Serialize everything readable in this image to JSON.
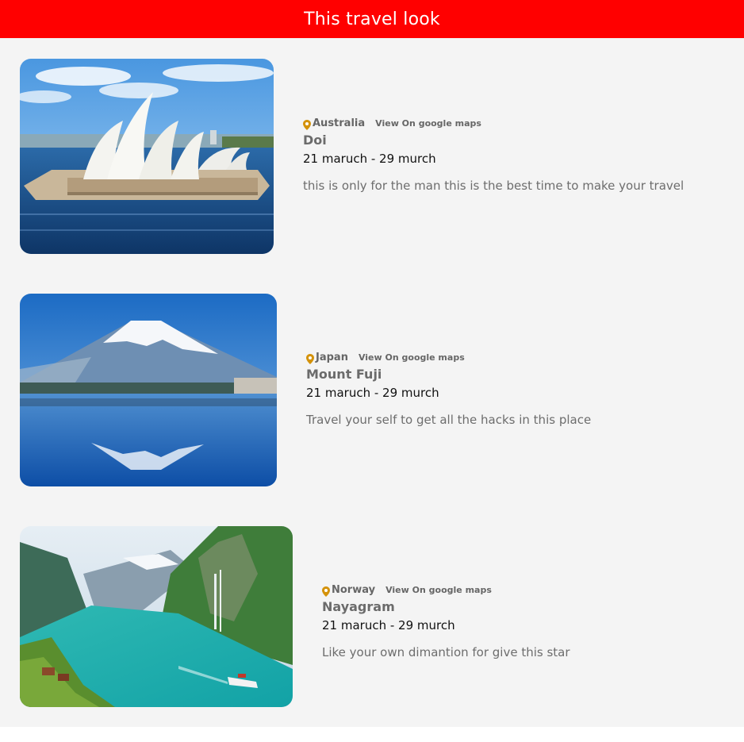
{
  "header": {
    "title": "This travel look"
  },
  "trips": [
    {
      "country": "Australia",
      "maps_label": "View On google maps",
      "place": "Doi",
      "dates": "21 maruch - 29 murch",
      "description": "this is only for the man this is the best time to make your travel"
    },
    {
      "country": "Japan",
      "maps_label": "View On google maps",
      "place": "Mount Fuji",
      "dates": "21 maruch - 29 murch",
      "description": "Travel your self to get all the hacks in this place"
    },
    {
      "country": "Norway",
      "maps_label": "View On google maps",
      "place": "Nayagram",
      "dates": "21 maruch - 29 murch",
      "description": "Like your own dimantion for give this star"
    }
  ],
  "colors": {
    "header_bg": "#ff0000",
    "page_bg": "#f4f4f4",
    "pin": "#d4920a"
  },
  "icons": {
    "location": "map-pin-icon"
  }
}
